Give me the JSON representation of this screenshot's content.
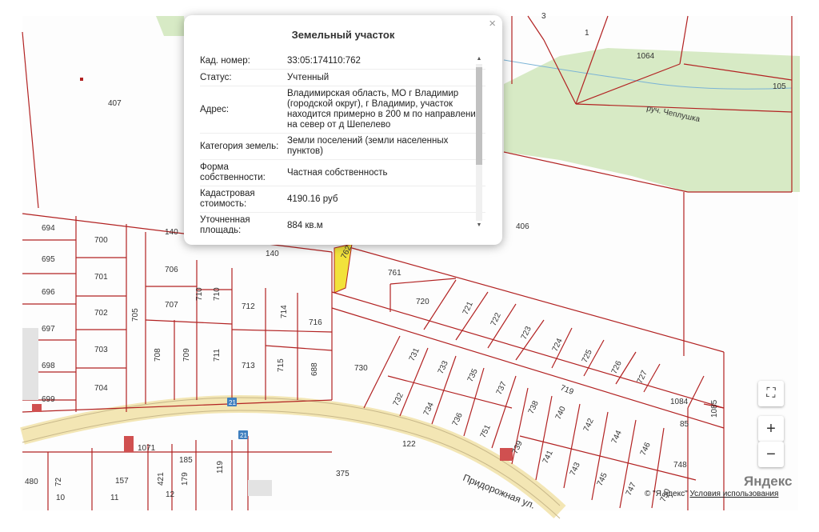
{
  "popup": {
    "title": "Земельный участок",
    "close_icon": "×",
    "rows": [
      {
        "key": "Кад. номер:",
        "value": "33:05:174110:762"
      },
      {
        "key": "Статус:",
        "value": "Учтенный"
      },
      {
        "key": "Адрес:",
        "value": "Владимирская область, МО г Владимир (городской округ), г Владимир, участок находится примерно в 200 м по направлению на север от д Шепелево"
      },
      {
        "key": "Категория земель:",
        "value": "Земли поселений (земли населенных пунктов)"
      },
      {
        "key": "Форма собственности:",
        "value": "Частная собственность"
      },
      {
        "key": "Кадастровая стоимость:",
        "value": "4190.16 руб"
      },
      {
        "key": "Уточненная площадь:",
        "value": "884 кв.м"
      }
    ]
  },
  "map": {
    "lots": [
      "694",
      "700",
      "695",
      "701",
      "696",
      "697",
      "702",
      "698",
      "703",
      "699",
      "704",
      "705",
      "706",
      "707",
      "708",
      "709",
      "710",
      "710",
      "711",
      "712",
      "713",
      "714",
      "715",
      "716",
      "688",
      "730",
      "731",
      "732",
      "733",
      "734",
      "735",
      "736",
      "737",
      "751",
      "738",
      "739",
      "740",
      "741",
      "742",
      "743",
      "744",
      "745",
      "746",
      "747",
      "748",
      "750",
      "719",
      "720",
      "721",
      "722",
      "723",
      "724",
      "725",
      "726",
      "727",
      "1084",
      "1085",
      "761",
      "762",
      "140",
      "140",
      "407",
      "406",
      "1064",
      "105",
      "3",
      "1",
      "122",
      "375",
      "1071",
      "185",
      "157",
      "421",
      "179",
      "119",
      "72",
      "480",
      "10",
      "11",
      "12",
      "85"
    ],
    "stream_name": "руч. Чеплушка",
    "road_name": "Придорожная ул.",
    "road_badge": "21",
    "colors": {
      "border": "#b22222",
      "forest": "#d7eac5",
      "road": "#f3e6b4",
      "selected": "#f2e23b"
    }
  },
  "controls": {
    "fullscreen_icon": "⛶",
    "zoom_in": "+",
    "zoom_out": "−"
  },
  "attribution": {
    "logo": "Яндекс",
    "copyright": "© \"Я ндекс\"",
    "terms": "Условия использования"
  }
}
